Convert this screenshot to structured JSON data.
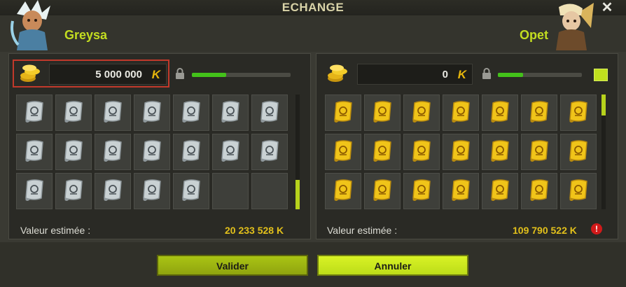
{
  "window": {
    "title": "ECHANGE",
    "close_label": "✕"
  },
  "left": {
    "player_name": "Greysa",
    "kamas_value": "5 000 000",
    "kama_symbol": "K",
    "progress": 0.35,
    "estimated_label": "Valeur estimée :",
    "estimated_value": "20 233 528 K",
    "item_count": 19,
    "item_icon": "silver-scroll-icon"
  },
  "right": {
    "player_name": "Opet",
    "kamas_value": "0",
    "kama_symbol": "K",
    "progress": 0.3,
    "estimated_label": "Valeur estimée :",
    "estimated_value": "109 790 522 K",
    "item_count": 21,
    "item_icon": "gold-scroll-icon",
    "warning_icon": "!"
  },
  "buttons": {
    "validate": "Valider",
    "cancel": "Annuler"
  },
  "colors": {
    "accent_green": "#c3dd20",
    "gold": "#e2c01b",
    "warning_red": "#d11a1a"
  }
}
